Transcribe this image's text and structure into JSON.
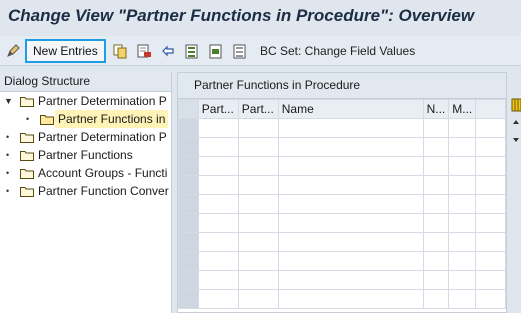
{
  "window": {
    "title": "Change View \"Partner Functions in Procedure\": Overview"
  },
  "toolbar": {
    "icons": [
      "edit-pencil-icon",
      "copy-icon",
      "delete-icon",
      "undo-icon",
      "select-all-icon",
      "select-block-icon",
      "deselect-all-icon"
    ],
    "new_entries_label": "New Entries",
    "bcset_label": "BC Set: Change Field Values"
  },
  "dialog_structure": {
    "header": "Dialog Structure",
    "items": [
      {
        "label": "Partner Determination P",
        "level": 0,
        "expanded": true
      },
      {
        "label": "Partner Functions in",
        "level": 1,
        "selected": true
      },
      {
        "label": "Partner Determination P",
        "level": 0
      },
      {
        "label": "Partner Functions",
        "level": 0
      },
      {
        "label": "Account Groups - Functi",
        "level": 0
      },
      {
        "label": "Partner Function Conver",
        "level": 0
      }
    ]
  },
  "table": {
    "title": "Partner Functions in Procedure",
    "columns": [
      "Part...",
      "Part...",
      "Name",
      "N...",
      "M..."
    ],
    "row_count": 10
  },
  "colors": {
    "accent": "#1e9de0",
    "selection": "#fff3b8",
    "title": "#1d2d44"
  }
}
